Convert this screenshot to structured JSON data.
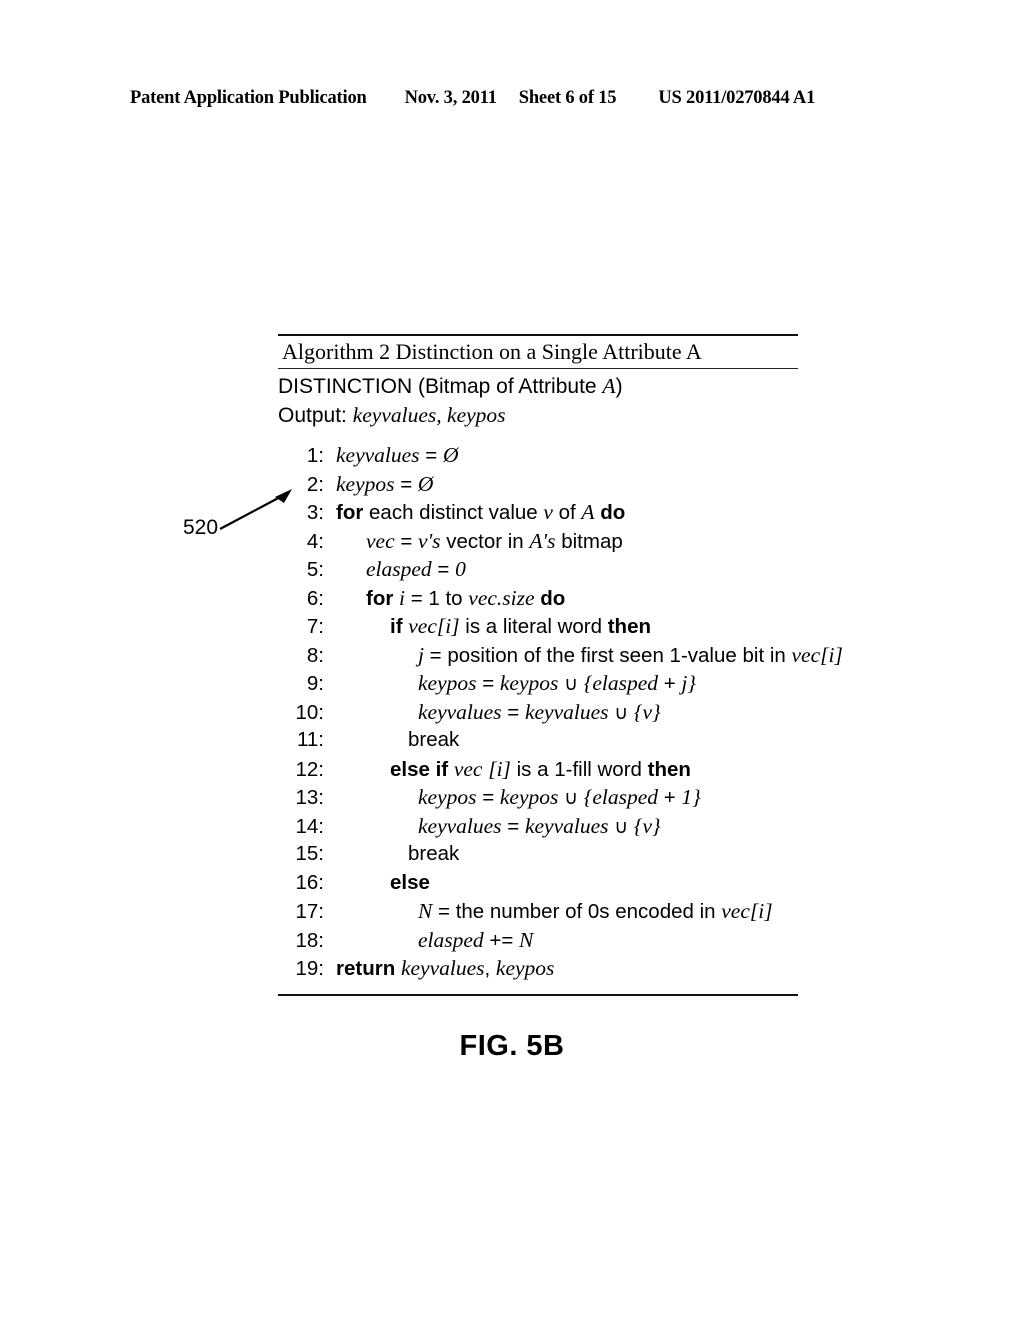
{
  "header": {
    "publication": "Patent Application Publication",
    "date": "Nov. 3, 2011",
    "sheet": "Sheet 6 of 15",
    "patent_number": "US 2011/0270844 A1"
  },
  "algorithm": {
    "title": "Algorithm 2 Distinction on a Single Attribute A",
    "signature_plain": "DISTINCTION (Bitmap of Attribute A)",
    "output_plain": "Output: keyvalues, keypos",
    "signature_parts": {
      "prefix": "DISTINCTION (Bitmap of Attribute ",
      "var": "A",
      "suffix": ")"
    },
    "output_parts": {
      "label": "Output: ",
      "var1": "keyvalues",
      "comma": ", ",
      "var2": "keypos"
    },
    "lines": [
      {
        "n": "1:",
        "indent": "i0",
        "text": "keyvalues = Ø"
      },
      {
        "n": "2:",
        "indent": "i0",
        "text": "keypos = Ø"
      },
      {
        "n": "3:",
        "indent": "i0",
        "text": "for each distinct value v of A do"
      },
      {
        "n": "4:",
        "indent": "i1",
        "text": "vec = v's vector in A's bitmap"
      },
      {
        "n": "5:",
        "indent": "i1",
        "text": "elasped = 0"
      },
      {
        "n": "6:",
        "indent": "i1",
        "text": "for i = 1 to vec.size do"
      },
      {
        "n": "7:",
        "indent": "i2",
        "text": "if vec[i] is a literal word then"
      },
      {
        "n": "8:",
        "indent": "i3",
        "text": "j = position of the first seen 1-value bit in vec[i]"
      },
      {
        "n": "9:",
        "indent": "i3",
        "text": "keypos = keypos ∪ {elasped + j}"
      },
      {
        "n": "10:",
        "indent": "i3",
        "text": "keyvalues = keyvalues ∪ {v}"
      },
      {
        "n": "11:",
        "indent": "i25",
        "text": "break"
      },
      {
        "n": "12:",
        "indent": "i2",
        "text": "else if vec [i] is a 1-fill word then"
      },
      {
        "n": "13:",
        "indent": "i3",
        "text": "keypos = keypos ∪ {elasped + 1}"
      },
      {
        "n": "14:",
        "indent": "i3",
        "text": "keyvalues = keyvalues ∪ {v}"
      },
      {
        "n": "15:",
        "indent": "i25",
        "text": "break"
      },
      {
        "n": "16:",
        "indent": "i2",
        "text": "else"
      },
      {
        "n": "17:",
        "indent": "i3",
        "text": "N = the number of 0s encoded in vec[i]"
      },
      {
        "n": "18:",
        "indent": "i3",
        "text": "elasped += N"
      },
      {
        "n": "19:",
        "indent": "i0",
        "text": "return keyvalues, keypos"
      }
    ]
  },
  "annotations": {
    "reference_numeral": "520"
  },
  "figure": {
    "caption": "FIG. 5B"
  },
  "colors": {
    "ink": "#000000",
    "page": "#ffffff"
  }
}
